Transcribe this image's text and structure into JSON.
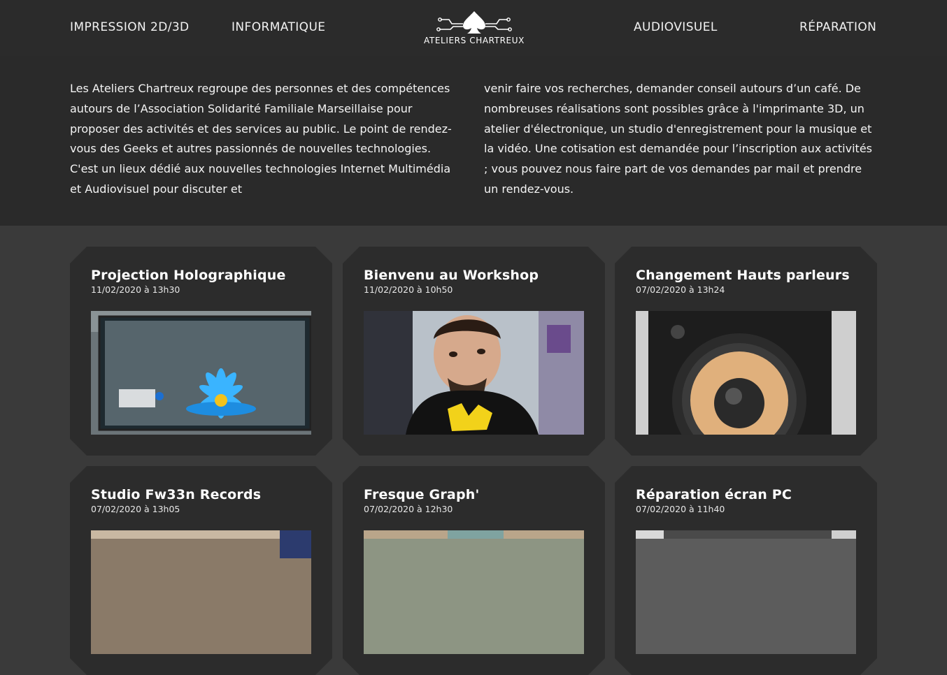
{
  "nav": {
    "links": [
      "IMPRESSION 2D/3D",
      "INFORMATIQUE",
      "AUDIOVISUEL",
      "RÉPARATION"
    ],
    "logo_text": "ATELIERS CHARTREUX"
  },
  "intro": {
    "left": "Les Ateliers Chartreux regroupe des personnes et des compétences autours de l’Association Solidarité Familiale Marseillaise pour proposer des activités et des services au public. Le point de rendez-vous des Geeks et autres passionnés de nouvelles technologies. C'est un lieux dédié aux nouvelles technologies Internet Multimédia et Audiovisuel pour discuter et",
    "right": "venir faire vos recherches, demander conseil autours d’un café. De nombreuses réalisations sont possibles grâce à l'imprimante 3D, un atelier d'électronique, un studio d'enregistrement pour la musique et la vidéo. Une cotisation est demandée pour l’inscription aux activités ; vous pouvez nous faire part de vos demandes par mail et prendre un rendez-vous."
  },
  "posts": [
    {
      "title": "Projection Holographique",
      "date": "11/02/2020 à 13h30",
      "image": "hologram-lotus-photo"
    },
    {
      "title": "Bienvenu au Workshop",
      "date": "11/02/2020 à 10h50",
      "image": "selfie-photo"
    },
    {
      "title": "Changement Hauts parleurs",
      "date": "07/02/2020 à 13h24",
      "image": "speaker-photo"
    },
    {
      "title": "Studio Fw33n Records",
      "date": "07/02/2020 à 13h05",
      "image": "studio-photo"
    },
    {
      "title": "Fresque Graph'",
      "date": "07/02/2020 à 12h30",
      "image": "graffiti-photo"
    },
    {
      "title": "Réparation écran PC",
      "date": "07/02/2020 à 11h40",
      "image": "screen-repair-photo"
    }
  ]
}
